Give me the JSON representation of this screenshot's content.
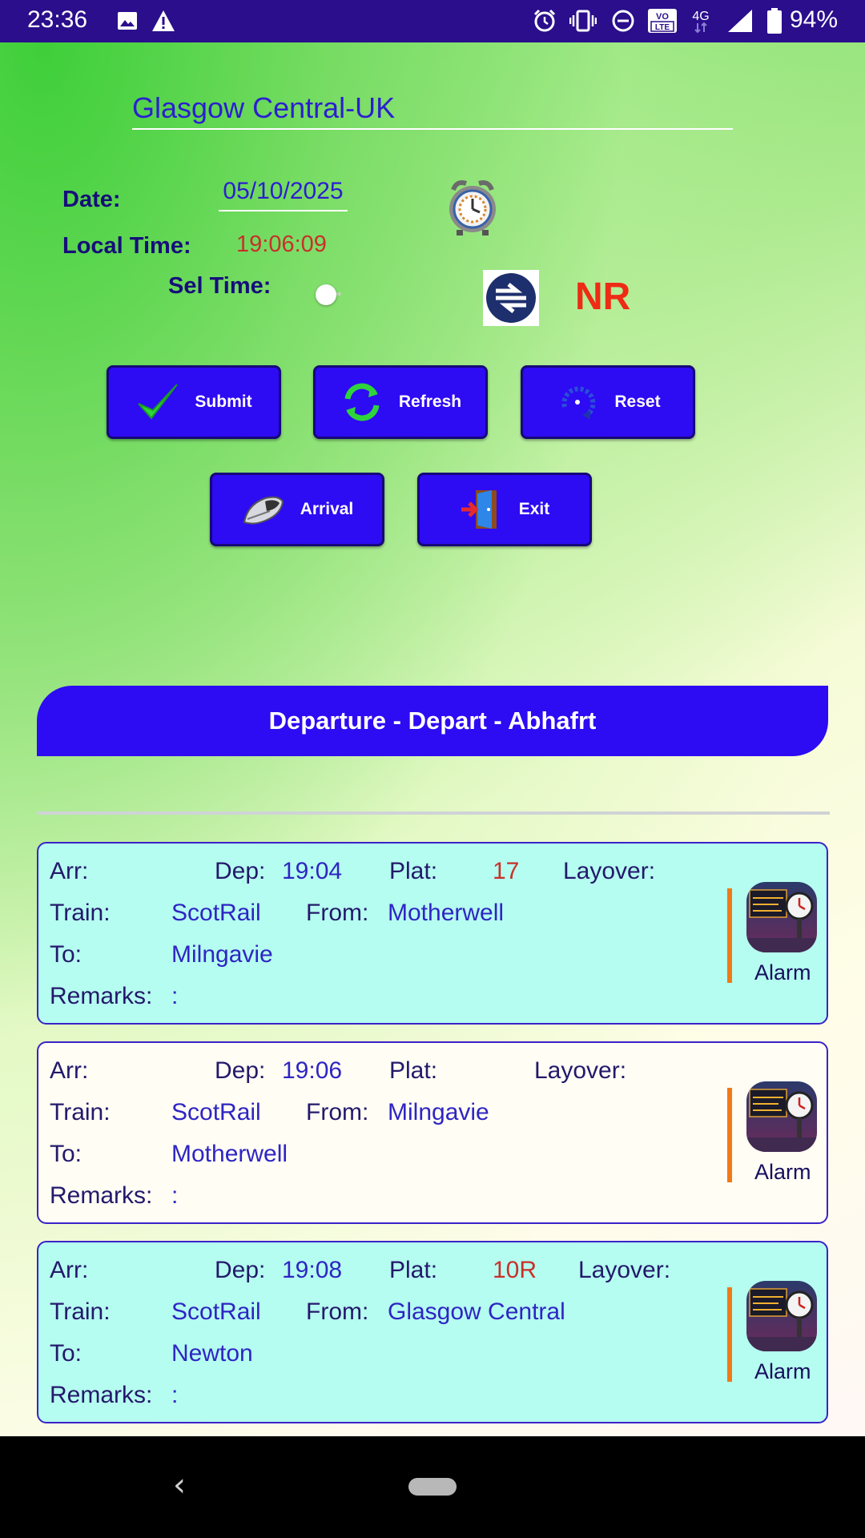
{
  "status_bar": {
    "time": "23:36",
    "battery": "94%",
    "icons": [
      "image-icon",
      "warning-icon",
      "alarm-icon",
      "vibrate-icon",
      "dnd-icon",
      "volte-icon",
      "4g-icon",
      "signal-icon",
      "battery-icon"
    ],
    "volte_text": "VO LTE",
    "network_text": "4G"
  },
  "header": {
    "station": "Glasgow Central-UK",
    "date_label": "Date:",
    "date_value": "05/10/2025",
    "local_time_label": "Local Time:",
    "local_time_value": "19:06:09",
    "sel_time_label": "Sel Time:",
    "nr_text": "NR"
  },
  "buttons": {
    "submit": "Submit",
    "refresh": "Refresh",
    "reset": "Reset",
    "arrival": "Arrival",
    "exit": "Exit"
  },
  "section_title": "Departure - Depart - Abhafrt",
  "labels": {
    "arr": "Arr:",
    "dep": "Dep:",
    "plat": "Plat:",
    "layover": "Layover:",
    "train": "Train:",
    "from": "From:",
    "to": "To:",
    "remarks": "Remarks:",
    "alarm": "Alarm"
  },
  "departures": [
    {
      "arr": "",
      "dep": "19:04",
      "plat": "17",
      "layover": "",
      "train": "ScotRail",
      "from": "Motherwell",
      "to": "Milngavie",
      "remarks": ":"
    },
    {
      "arr": "",
      "dep": "19:06",
      "plat": "",
      "layover": "",
      "train": "ScotRail",
      "from": "Milngavie",
      "to": "Motherwell",
      "remarks": ":"
    },
    {
      "arr": "",
      "dep": "19:08",
      "plat": "10R",
      "layover": "",
      "train": "ScotRail",
      "from": "Glasgow Central",
      "to": "Newton",
      "remarks": ":"
    }
  ],
  "colors": {
    "status_bar": "#2a0e8c",
    "button": "#2d0bf3",
    "card_bg": "#b5fdf0",
    "accent_orange": "#f07a16",
    "nr_red": "#ee2b15"
  }
}
